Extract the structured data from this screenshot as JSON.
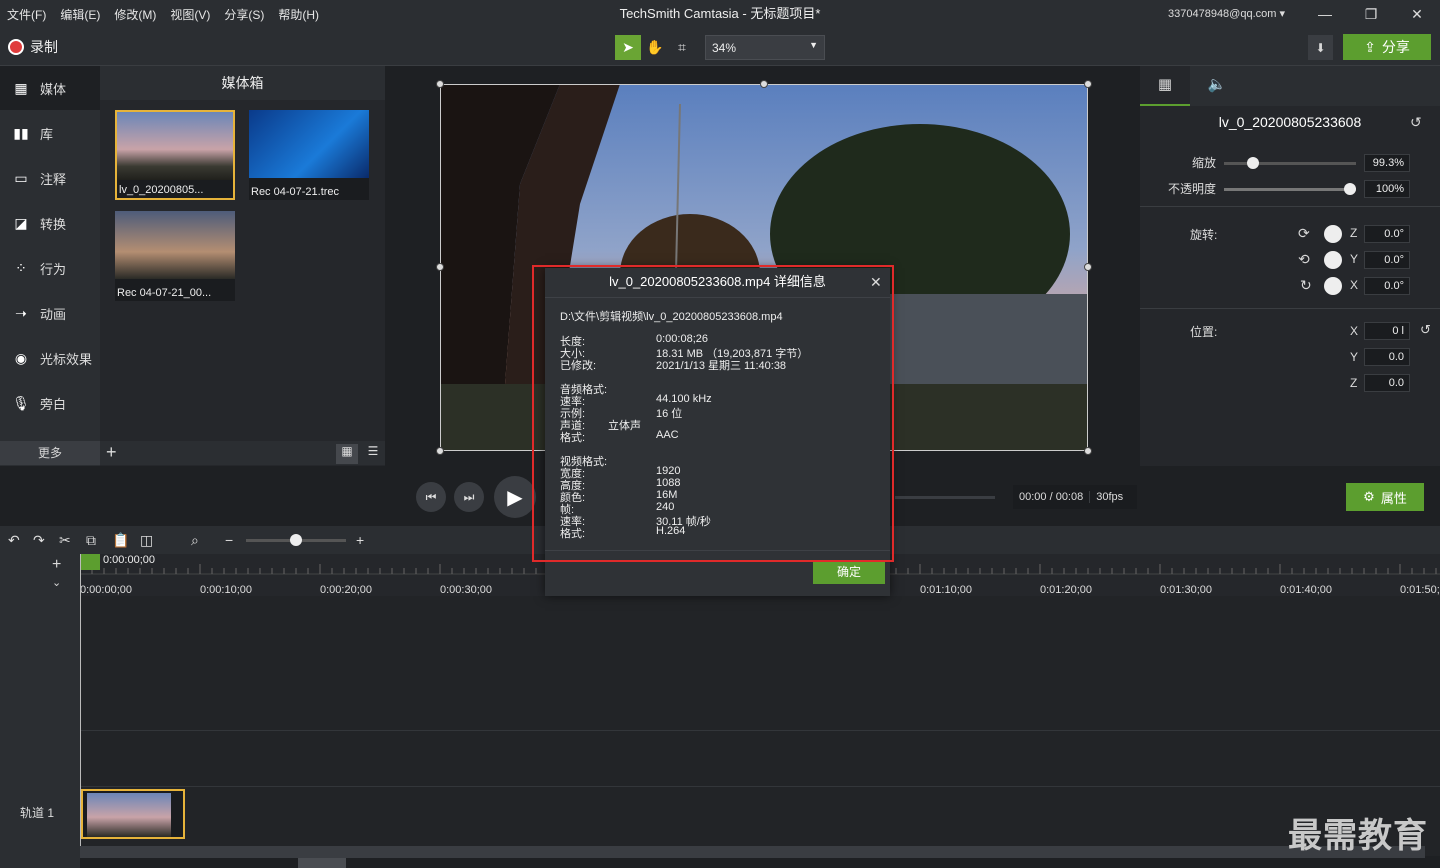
{
  "menu": [
    "文件(F)",
    "编辑(E)",
    "修改(M)",
    "视图(V)",
    "分享(S)",
    "帮助(H)"
  ],
  "app_title": "TechSmith Camtasia - 无标题项目*",
  "account": "3370478948@qq.com",
  "record_label": "录制",
  "zoom": "34%",
  "share_label": "分享",
  "sidebar": {
    "items": [
      {
        "label": "媒体",
        "icon": "film-icon"
      },
      {
        "label": "库",
        "icon": "library-icon"
      },
      {
        "label": "注释",
        "icon": "annotation-icon"
      },
      {
        "label": "转换",
        "icon": "transition-icon"
      },
      {
        "label": "行为",
        "icon": "behavior-icon"
      },
      {
        "label": "动画",
        "icon": "animation-icon"
      },
      {
        "label": "光标效果",
        "icon": "cursor-icon"
      },
      {
        "label": "旁白",
        "icon": "mic-icon"
      }
    ],
    "more": "更多"
  },
  "media_bin": {
    "title": "媒体箱",
    "items": [
      {
        "caption": "lv_0_20200805..."
      },
      {
        "caption": "Rec 04-07-21.trec"
      },
      {
        "caption": "Rec 04-07-21_00..."
      }
    ]
  },
  "properties": {
    "clip_name": "lv_0_20200805233608",
    "scale_label": "缩放",
    "scale_value": "99.3%",
    "opacity_label": "不透明度",
    "opacity_value": "100%",
    "rotation_label": "旋转:",
    "rot_z": "0.0°",
    "rot_y": "0.0°",
    "rot_x": "0.0°",
    "position_label": "位置:",
    "pos_x": "0 l",
    "pos_y": "0.0",
    "pos_z": "0.0",
    "axis_z": "Z",
    "axis_y": "Y",
    "axis_x": "X"
  },
  "playback": {
    "time": "00:00 / 00:08",
    "fps": "30fps",
    "attr_label": "属性"
  },
  "timeline": {
    "playhead": "0:00:00;00",
    "ticks": [
      "0:00:00;00",
      "0:00:10;00",
      "0:00:20;00",
      "0:00:30;00",
      "0:01:10;00",
      "0:01:20;00",
      "0:01:30;00",
      "0:01:40;00",
      "0:01:50;"
    ],
    "track_label": "轨道 1"
  },
  "dialog": {
    "title": "lv_0_20200805233608.mp4 详细信息",
    "path": "D:\\文件\\剪辑视频\\lv_0_20200805233608.mp4",
    "length_label": "长度:",
    "length": "0:00:08;26",
    "size_label": "大小:",
    "size": "18.31 MB （19,203,871 字节）",
    "modified_label": "已修改:",
    "modified": "2021/1/13 星期三 11:40:38",
    "audio_heading": "音频格式:",
    "rate_label": "速率:",
    "audio_rate": "44.100 kHz",
    "sample_label": "示例:",
    "sample": "16 位",
    "channel_label": "声道:",
    "channel": "立体声",
    "format_label": "格式:",
    "audio_format": "AAC",
    "video_heading": "视频格式:",
    "width_label": "宽度:",
    "width": "1920",
    "height_label": "高度:",
    "height": "1088",
    "color_label": "颜色:",
    "color": "16M",
    "frames_label": "帧:",
    "frames": "240",
    "video_rate": "30.11 帧/秒",
    "video_format": "H.264",
    "ok": "确定"
  },
  "watermark": "最需教育",
  "colors": {
    "accent": "#5c9e2f",
    "highlight": "#e02a2a",
    "selection": "#e6b33a"
  }
}
